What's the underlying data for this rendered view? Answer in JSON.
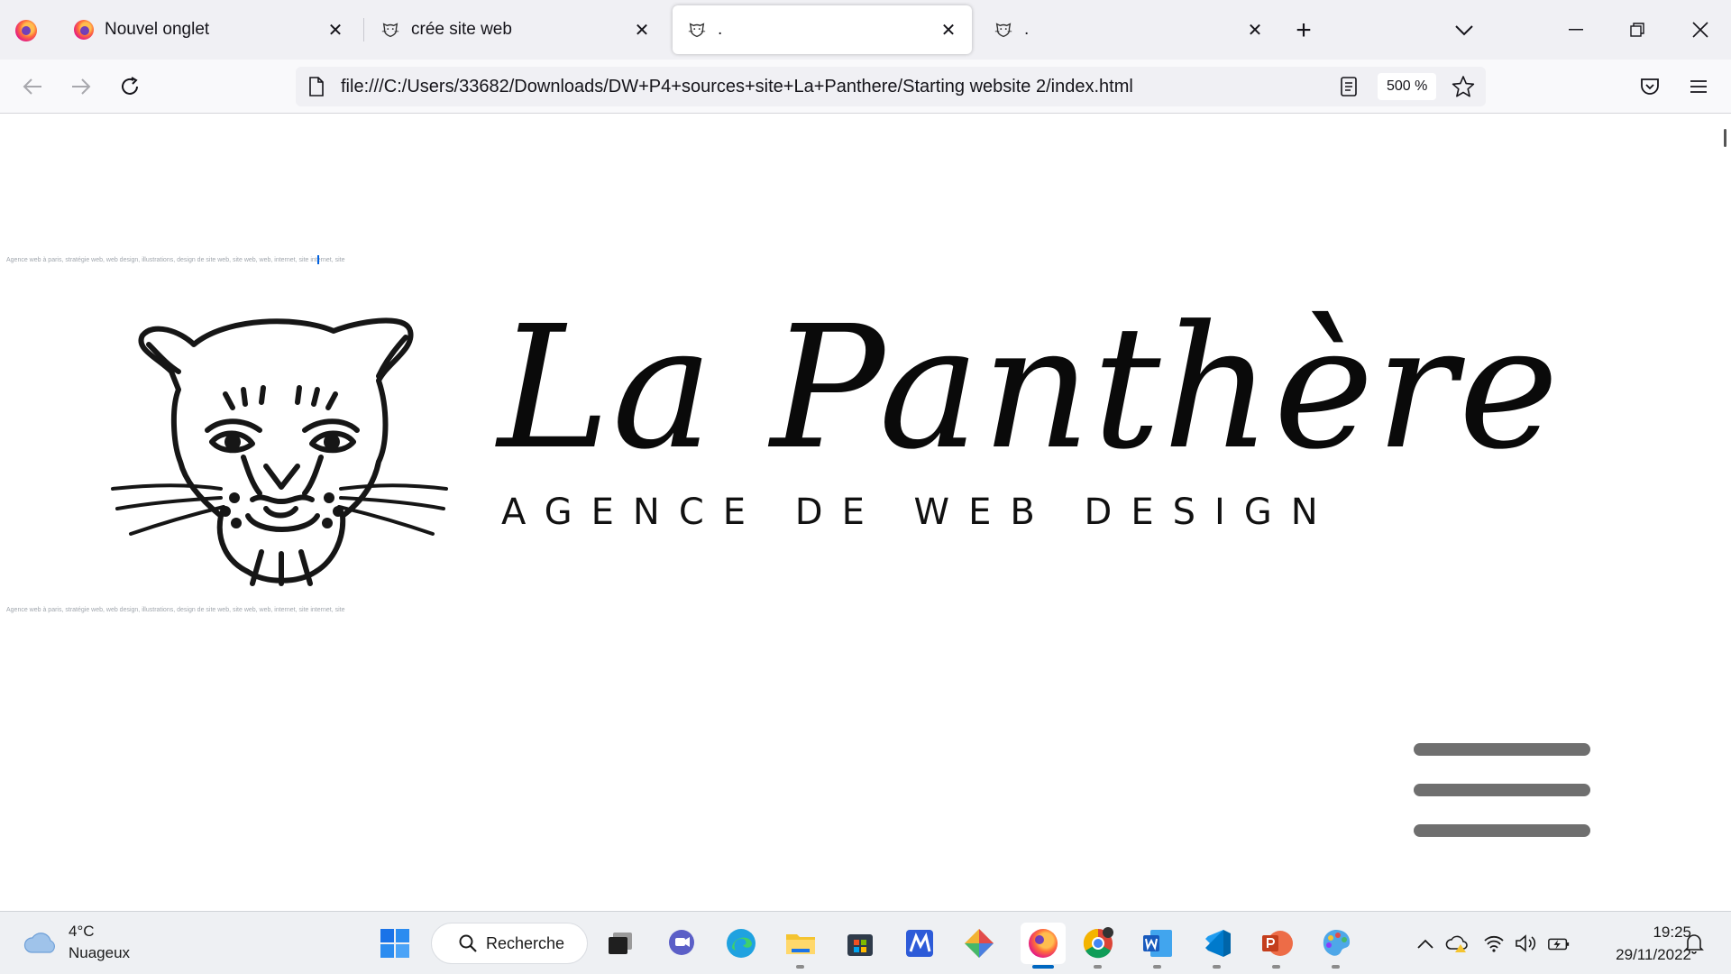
{
  "browser": {
    "tabs": [
      {
        "label": "Nouvel onglet",
        "icon": "firefox-icon",
        "active": false
      },
      {
        "label": "crée site web",
        "icon": "panther-favicon-icon",
        "active": false
      },
      {
        "label": ".",
        "icon": "panther-favicon-icon",
        "active": true
      },
      {
        "label": ".",
        "icon": "panther-favicon-icon",
        "active": false
      }
    ],
    "url": "file:///C:/Users/33682/Downloads/DW+P4+sources+site+La+Panthere/Starting website 2/index.html",
    "zoom": "500 %"
  },
  "page": {
    "meta_text_top": "Agence web à paris, stratégie web, web design, illustrations, design de site web, site web, web, internet, site internet, site",
    "meta_text_bottom": "Agence web à paris, stratégie web, web design, illustrations, design de site web, site web, web, internet, site internet, site",
    "brand_title": "La Panthère",
    "brand_subtitle": "AGENCE DE WEB DESIGN"
  },
  "taskbar": {
    "weather_temp": "4°C",
    "weather_desc": "Nuageux",
    "search_label": "Recherche",
    "time": "19:25",
    "date": "29/11/2022"
  },
  "colors": {
    "tabstrip_bg": "#f0f0f4",
    "navbar_bg": "#f9f9fb",
    "hamburger_bar": "#6f6f6f",
    "taskbar_bg": "#eef0f3",
    "active_indicator": "#0067c0"
  }
}
